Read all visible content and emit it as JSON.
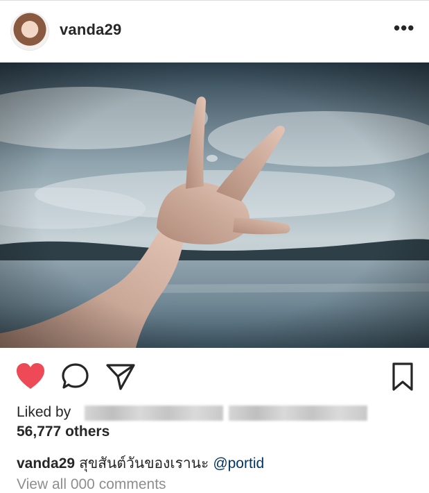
{
  "post": {
    "username": "vanda29",
    "more_label": "•••",
    "photo_alt": "photo",
    "liked_by_prefix": "Liked by",
    "others_count": "56,777 others",
    "caption": {
      "username": "vanda29",
      "text": "สุขสันต์วันของเรานะ",
      "mention": "@portid"
    },
    "view_all_comments": "View all 000 comments"
  },
  "icons": {
    "like": "heart-icon",
    "comment": "comment-icon",
    "share": "send-icon",
    "save": "bookmark-icon",
    "more": "more-icon"
  },
  "colors": {
    "like": "#ed4956",
    "text": "#262626",
    "mention": "#003569",
    "muted": "#8e8e8e"
  }
}
